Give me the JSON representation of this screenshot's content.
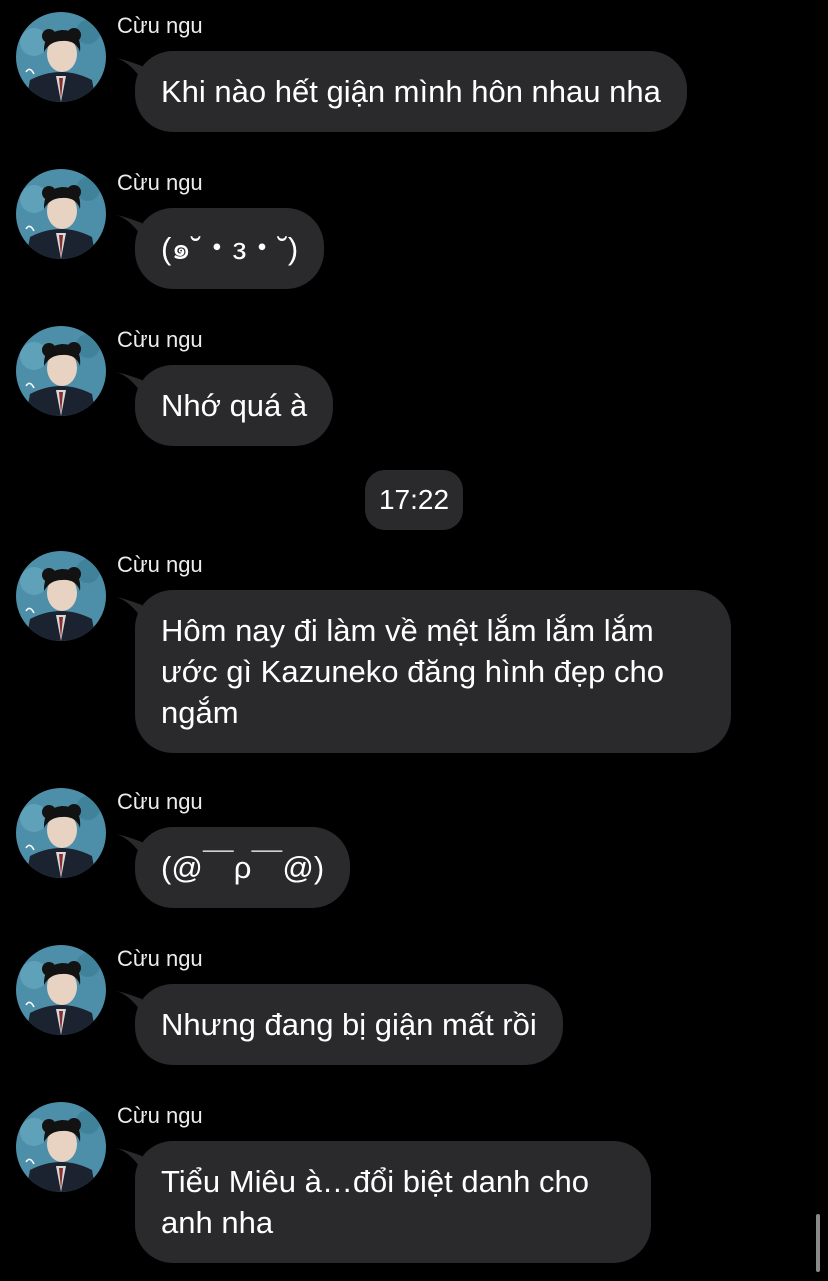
{
  "colors": {
    "background": "#000000",
    "bubble": "#2a2a2c",
    "text": "#ffffff",
    "sender_text": "#ececec"
  },
  "timestamp": "17:22",
  "messages": [
    {
      "sender": "Cừu ngu",
      "text": "Khi nào hết giận mình hôn nhau nha",
      "avatar_icon": "profile-avatar-icon"
    },
    {
      "sender": "Cừu ngu",
      "text": "(๑˘・з・˘)",
      "avatar_icon": "profile-avatar-icon"
    },
    {
      "sender": "Cừu ngu",
      "text": "Nhớ quá à",
      "avatar_icon": "profile-avatar-icon"
    },
    {
      "sender": "Cừu ngu",
      "text": "Hôm nay đi làm về mệt lắm lắm lắm ước gì Kazuneko đăng hình đẹp cho ngắm",
      "avatar_icon": "profile-avatar-icon"
    },
    {
      "sender": "Cừu ngu",
      "text": "(@￣ρ￣@)",
      "avatar_icon": "profile-avatar-icon"
    },
    {
      "sender": "Cừu ngu",
      "text": "Nhưng đang bị giận mất rồi",
      "avatar_icon": "profile-avatar-icon"
    },
    {
      "sender": "Cừu ngu",
      "text": "Tiểu Miêu à…đổi biệt danh cho anh nha",
      "avatar_icon": "profile-avatar-icon"
    }
  ]
}
